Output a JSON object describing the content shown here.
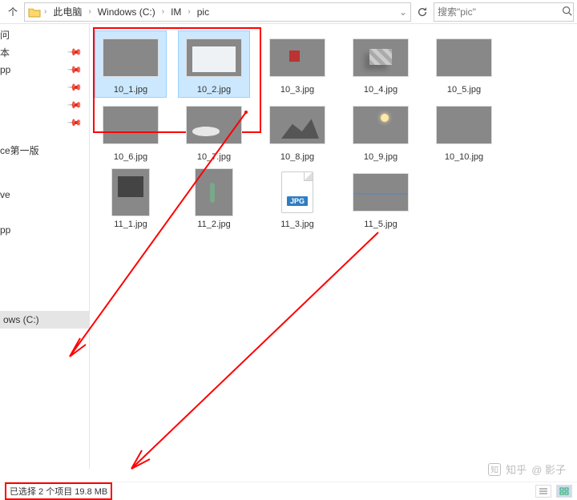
{
  "breadcrumbs": [
    "此电脑",
    "Windows (C:)",
    "IM",
    "pic"
  ],
  "up_label": "个",
  "search": {
    "placeholder": "搜索\"pic\""
  },
  "sidebar": {
    "quick": [
      {
        "label": "问",
        "pinned": false
      },
      {
        "label": "本",
        "pinned": true
      },
      {
        "label": "pp",
        "pinned": true
      },
      {
        "label": "",
        "pinned": true
      },
      {
        "label": "",
        "pinned": true
      },
      {
        "label": "",
        "pinned": true
      }
    ],
    "group2": [
      {
        "label": "ce第一版"
      },
      {
        "label": ""
      },
      {
        "label": "ve"
      },
      {
        "label": ""
      },
      {
        "label": "pp"
      }
    ],
    "drive": "ows (C:)"
  },
  "files": [
    {
      "name": "10_1.jpg",
      "selected": true,
      "thumb": "t-city",
      "shape": "land"
    },
    {
      "name": "10_2.jpg",
      "selected": true,
      "thumb": "t-hall",
      "shape": "land"
    },
    {
      "name": "10_3.jpg",
      "selected": false,
      "thumb": "t-bench",
      "shape": "land"
    },
    {
      "name": "10_4.jpg",
      "selected": false,
      "thumb": "t-cubes",
      "shape": "land"
    },
    {
      "name": "10_5.jpg",
      "selected": false,
      "thumb": "t-bw",
      "shape": "land"
    },
    {
      "name": "10_6.jpg",
      "selected": false,
      "thumb": "t-field",
      "shape": "land"
    },
    {
      "name": "10_7.jpg",
      "selected": false,
      "thumb": "t-sky",
      "shape": "land"
    },
    {
      "name": "10_8.jpg",
      "selected": false,
      "thumb": "t-snow",
      "shape": "land"
    },
    {
      "name": "10_9.jpg",
      "selected": false,
      "thumb": "t-sunset",
      "shape": "land"
    },
    {
      "name": "10_10.jpg",
      "selected": false,
      "thumb": "t-vert",
      "shape": "land"
    },
    {
      "name": "11_1.jpg",
      "selected": false,
      "thumb": "t-gallery",
      "shape": "port"
    },
    {
      "name": "11_2.jpg",
      "selected": false,
      "thumb": "t-dark",
      "shape": "port"
    },
    {
      "name": "11_3.jpg",
      "selected": false,
      "thumb": "blank",
      "shape": "blank",
      "badge": "JPG"
    },
    {
      "name": "11_5.jpg",
      "selected": false,
      "thumb": "t-lake",
      "shape": "land"
    }
  ],
  "status": {
    "text": "已选择 2 个项目  19.8 MB"
  },
  "watermark": {
    "site": "知乎",
    "author": "@ 影子"
  }
}
